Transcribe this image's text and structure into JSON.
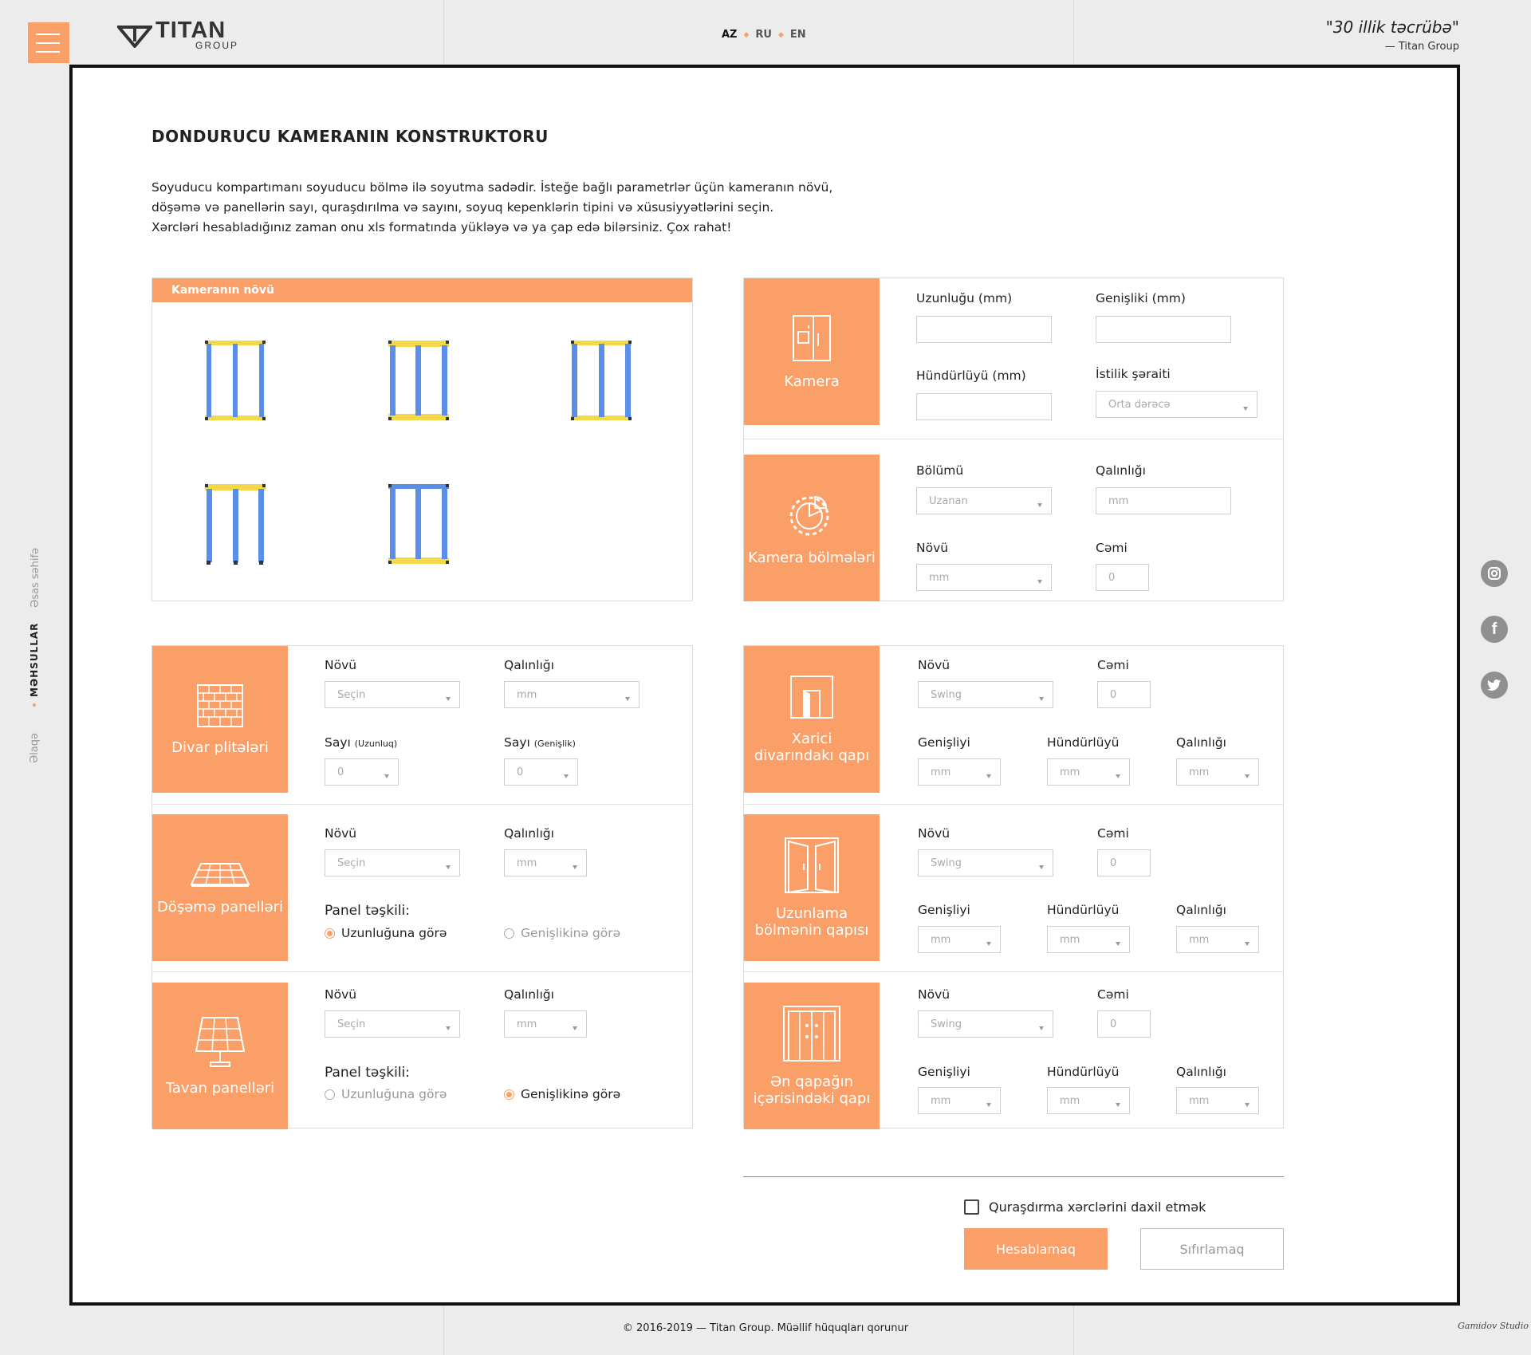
{
  "brand": {
    "name": "TITAN",
    "sub": "GROUP"
  },
  "langs": [
    "AZ",
    "RU",
    "EN"
  ],
  "quote": {
    "text": "\"30 illik təcrübə\"",
    "author": "— Titan Group"
  },
  "sidenav": {
    "home": "Əsas səhifə",
    "products": "MƏHSULLAR",
    "contact": "Əlaqə"
  },
  "page": {
    "title": "DONDURUCU KAMERANIN KONSTRUKTORU",
    "intro": [
      "Soyuducu kompartımanı soyuducu bölmə ilə soyutma sadədir. İsteğe bağlı parametrlər üçün kameranın növü,",
      "döşəmə və panellərin sayı, quraşdırılma və sayını, soyuq kepenklərin tipini və xüsusiyyətlərini seçin.",
      "Xərcləri hesabladığınız zaman onu xls formatında yükləyə və ya çap edə bilərsiniz. Çox rahat!"
    ]
  },
  "camera_type": {
    "header": "Kameranın növü"
  },
  "camera": {
    "tile": "Kamera",
    "length_label": "Uzunluğu (mm)",
    "width_label": "Genişliki (mm)",
    "height_label": "Hündürlüyü (mm)",
    "thermal_label": "İstilik şəraiti",
    "thermal_value": "Orta dərəcə"
  },
  "sections": {
    "tile": "Kamera bölmələri",
    "section_label": "Bölümü",
    "section_value": "Uzanan",
    "thickness_label": "Qalınlığı",
    "thickness_value": "mm",
    "type_label": "Növü",
    "type_value": "mm",
    "total_label": "Cəmi",
    "total_value": "0"
  },
  "wall": {
    "tile": "Divar plitələri",
    "type_label": "Növü",
    "type_value": "Seçin",
    "thickness_label": "Qalınlığı",
    "thickness_value": "mm",
    "count_len_label": "Sayı",
    "count_len_small": "(Uzunluq)",
    "count_len_value": "0",
    "count_wid_label": "Sayı",
    "count_wid_small": "(Genişlik)",
    "count_wid_value": "0"
  },
  "floor": {
    "tile": "Döşəmə panelləri",
    "type_label": "Növü",
    "type_value": "Seçin",
    "thickness_label": "Qalınlığı",
    "thickness_value": "mm",
    "layout_label": "Panel təşkili:",
    "opt1": "Uzunluğuna görə",
    "opt2": "Genişlikinə görə"
  },
  "ceiling": {
    "tile": "Tavan panelləri",
    "type_label": "Növü",
    "type_value": "Seçin",
    "thickness_label": "Qalınlığı",
    "thickness_value": "mm",
    "layout_label": "Panel təşkili:",
    "opt1": "Uzunluğuna görə",
    "opt2": "Genişlikinə görə"
  },
  "door1": {
    "tile": "Xarici divarındakı qapı",
    "type_label": "Növü",
    "type_value": "Swing",
    "total_label": "Cəmi",
    "total_value": "0",
    "width_label": "Genişliyi",
    "width_value": "mm",
    "height_label": "Hündürlüyü",
    "height_value": "mm",
    "thick_label": "Qalınlığı",
    "thick_value": "mm"
  },
  "door2": {
    "tile": "Uzunlama bölmənin qapısı",
    "type_label": "Növü",
    "type_value": "Swing",
    "total_label": "Cəmi",
    "total_value": "0",
    "width_label": "Genişliyi",
    "width_value": "mm",
    "height_label": "Hündürlüyü",
    "height_value": "mm",
    "thick_label": "Qalınlığı",
    "thick_value": "mm"
  },
  "door3": {
    "tile": "Ən qapağın içərisindəki qapı",
    "type_label": "Növü",
    "type_value": "Swing",
    "total_label": "Cəmi",
    "total_value": "0",
    "width_label": "Genişliyi",
    "width_value": "mm",
    "height_label": "Hündürlüyü",
    "height_value": "mm",
    "thick_label": "Qalınlığı",
    "thick_value": "mm"
  },
  "actions": {
    "include_install": "Quraşdırma xərclərini daxil etmək",
    "calculate": "Hesablamaq",
    "reset": "Sıfırlamaq"
  },
  "footer": {
    "copyright": "© 2016-2019 — Titan Group. Müəllif hüquqları qorunur",
    "studio": "Gamidov Studio"
  },
  "colors": {
    "accent": "#fa9f68",
    "frame_blue": "#5b8ee6",
    "frame_yellow": "#f3d84a"
  }
}
